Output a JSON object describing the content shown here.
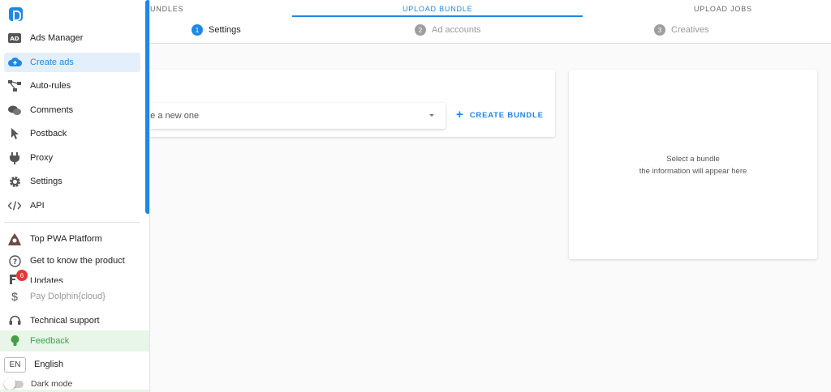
{
  "sidebar": {
    "items": [
      {
        "label": "Ads Manager",
        "icon": "ads-manager-icon"
      },
      {
        "label": "Create ads",
        "icon": "cloud-upload-icon",
        "active": true
      },
      {
        "label": "Auto-rules",
        "icon": "auto-rules-icon"
      },
      {
        "label": "Comments",
        "icon": "comments-icon"
      },
      {
        "label": "Postback",
        "icon": "cursor-icon"
      },
      {
        "label": "Proxy",
        "icon": "plug-icon"
      },
      {
        "label": "Settings",
        "icon": "gear-icon"
      },
      {
        "label": "API",
        "icon": "code-icon"
      }
    ],
    "extra": [
      {
        "label": "Top PWA Platform",
        "icon": "pwa-logo-icon"
      },
      {
        "label": "Get to know the product",
        "icon": "help-icon"
      },
      {
        "label": "Updates",
        "icon": "updates-icon",
        "badge": "6"
      },
      {
        "label": "Pay Dolphin{cloud}",
        "icon": "dollar-icon"
      },
      {
        "label": "Technical support",
        "icon": "headset-icon"
      }
    ],
    "feedback": {
      "label": "Feedback",
      "icon": "lightbulb-icon"
    },
    "language": {
      "code": "EN",
      "label": "English"
    },
    "dark_mode": {
      "label": "Dark mode",
      "on": false
    },
    "brand_color": "#1e88e5"
  },
  "tabs": [
    {
      "label": "UNDLES"
    },
    {
      "label": "UPLOAD BUNDLE",
      "active": true
    },
    {
      "label": "UPLOAD JOBS"
    }
  ],
  "steps": [
    {
      "num": "1",
      "label": "Settings",
      "active": true
    },
    {
      "num": "2",
      "label": "Ad accounts"
    },
    {
      "num": "3",
      "label": "Creatives"
    }
  ],
  "main": {
    "select_text": "ate a new one",
    "create_button": "CREATE BUNDLE",
    "info_line1": "Select a bundle",
    "info_line2": "the information will appear here"
  }
}
